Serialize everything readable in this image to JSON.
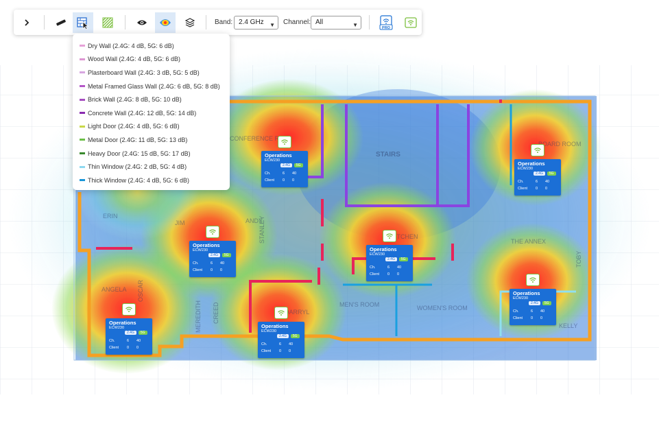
{
  "toolbar": {
    "band_label": "Band:",
    "band_value": "2.4 GHz",
    "channel_label": "Channel:",
    "channel_value": "All",
    "pro_badge": "PRO",
    "icons": [
      "chevron-right-icon",
      "measure-tool-icon",
      "wall-tool-icon",
      "hatch-area-icon",
      "eye-icon",
      "heatmap-icon",
      "layers-icon",
      "pro-access-point-icon",
      "wifi-icon"
    ]
  },
  "wall_types": [
    {
      "label": "Dry Wall (2.4G: 4 dB, 5G: 6 dB)",
      "color": "#e6a2d8"
    },
    {
      "label": "Wood Wall (2.4G: 4 dB, 5G: 6 dB)",
      "color": "#dd96d2"
    },
    {
      "label": "Plasterboard Wall (2.4G: 3 dB, 5G: 5 dB)",
      "color": "#d8a6e0"
    },
    {
      "label": "Metal Framed Glass Wall (2.4G: 6 dB, 5G: 8 dB)",
      "color": "#b557c8"
    },
    {
      "label": "Brick Wall (2.4G: 8 dB, 5G: 10 dB)",
      "color": "#a64ec0"
    },
    {
      "label": "Concrete Wall (2.4G: 12 dB, 5G: 14 dB)",
      "color": "#8a2bb0"
    },
    {
      "label": "Light Door (2.4G: 4 dB, 5G: 6 dB)",
      "color": "#c9d84a"
    },
    {
      "label": "Metal Door (2.4G: 11 dB, 5G: 13 dB)",
      "color": "#6cbf48"
    },
    {
      "label": "Heavy Door (2.4G: 15 dB, 5G: 17 dB)",
      "color": "#3a8a2e"
    },
    {
      "label": "Thin Window (2.4G: 2 dB, 5G: 4 dB)",
      "color": "#8fd9f0"
    },
    {
      "label": "Thick Window (2.4G: 4 dB, 5G: 6 dB)",
      "color": "#1a96d8"
    }
  ],
  "rooms": [
    "STAIRS",
    "CONFERENCE RM",
    "BOARD ROOM",
    "ERIN",
    "JIM",
    "ANDY",
    "STANLEY",
    "KITCHEN",
    "THE ANNEX",
    "TOBY",
    "ANGELA",
    "OSCAR",
    "MEREDITH",
    "CREED",
    "DARRYL",
    "MEN'S ROOM",
    "WOMEN'S ROOM",
    "KELLY"
  ],
  "access_points": [
    {
      "name": "Operations",
      "model": "ECW230",
      "band_24": "2.4G",
      "band_5": "5G",
      "ch_label": "Ch.",
      "ch_24": "6",
      "ch_5": "40",
      "client_label": "Client",
      "client_24": "0",
      "client_5": "0"
    },
    {
      "name": "Operations",
      "model": "ECW230",
      "band_24": "2.4G",
      "band_5": "5G",
      "ch_label": "Ch.",
      "ch_24": "6",
      "ch_5": "40",
      "client_label": "Client",
      "client_24": "0",
      "client_5": "0"
    },
    {
      "name": "Operations",
      "model": "ECW230",
      "band_24": "2.4G",
      "band_5": "5G",
      "ch_label": "Ch.",
      "ch_24": "6",
      "ch_5": "40",
      "client_label": "Client",
      "client_24": "0",
      "client_5": "0"
    },
    {
      "name": "Operations",
      "model": "ECW230",
      "band_24": "2.4G",
      "band_5": "5G",
      "ch_label": "Ch.",
      "ch_24": "6",
      "ch_5": "40",
      "client_label": "Client",
      "client_24": "0",
      "client_5": "0"
    },
    {
      "name": "Operations",
      "model": "ECW230",
      "band_24": "2.4G",
      "band_5": "5G",
      "ch_label": "Ch.",
      "ch_24": "6",
      "ch_5": "40",
      "client_label": "Client",
      "client_24": "0",
      "client_5": "0"
    },
    {
      "name": "Operations",
      "model": "ECW230",
      "band_24": "2.4G",
      "band_5": "5G",
      "ch_label": "Ch.",
      "ch_24": "6",
      "ch_5": "40",
      "client_label": "Client",
      "client_24": "0",
      "client_5": "0"
    },
    {
      "name": "Operations",
      "model": "ECW230",
      "band_24": "2.4G",
      "band_5": "5G",
      "ch_label": "Ch.",
      "ch_24": "6",
      "ch_5": "40",
      "client_label": "Client",
      "client_24": "0",
      "client_5": "0"
    }
  ],
  "colors": {
    "outer_wall": "#f5a023",
    "interior_wall_red": "#e8245a",
    "concrete_wall": "#8a44e0",
    "thick_window": "#1aa0e0",
    "thin_window": "#8fe0f0",
    "ap_card": "#1b6fd6",
    "heat_strong": "#ff2a1a",
    "heat_mid": "#ffe21a",
    "heat_weak": "#22c0e0"
  }
}
